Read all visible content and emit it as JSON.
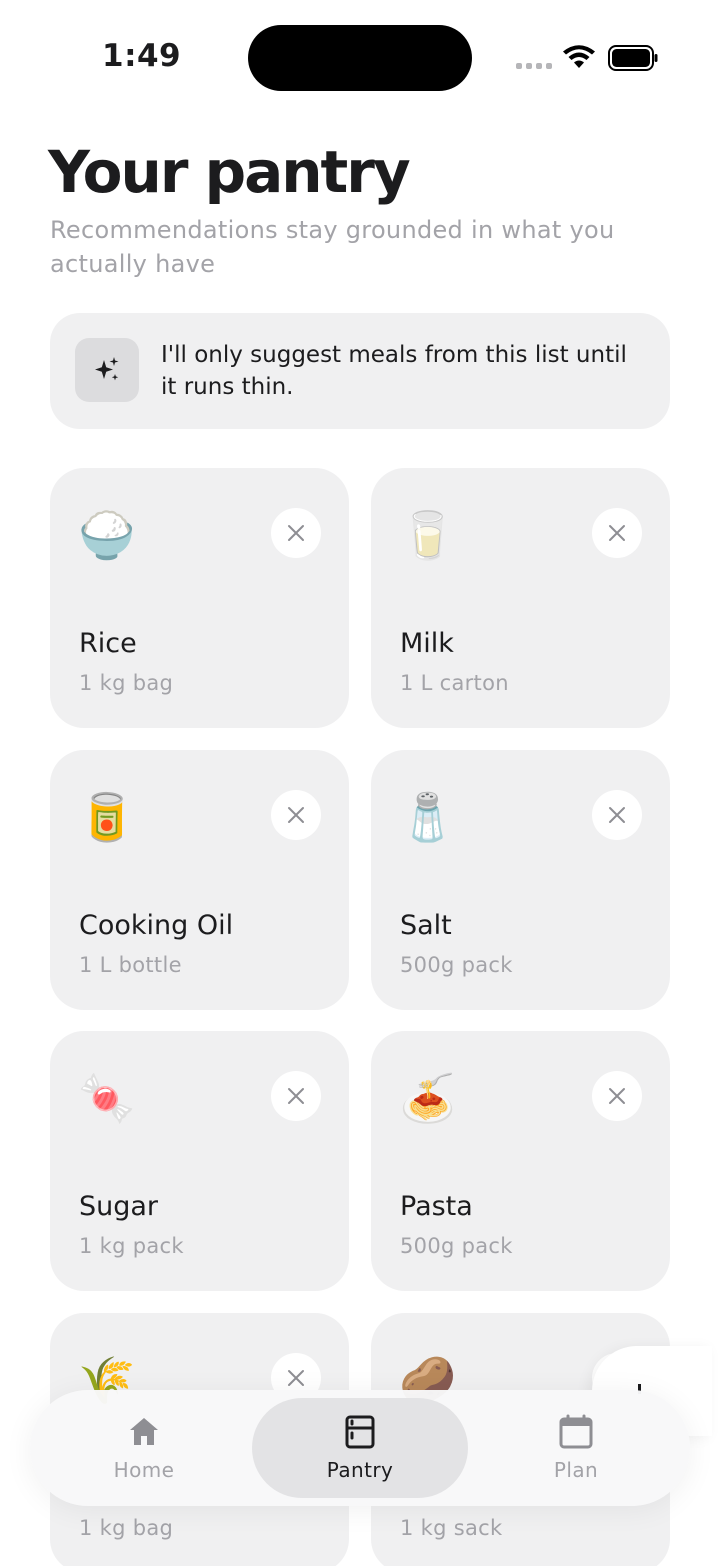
{
  "status_bar": {
    "time": "1:49"
  },
  "header": {
    "title": "Your pantry",
    "subtitle": "Recommendations stay grounded in what you actually have"
  },
  "banner": {
    "icon": "sparkles-icon",
    "text": "I'll only suggest meals from this list until it runs thin."
  },
  "pantry_items": [
    {
      "emoji": "🍚",
      "name": "Rice",
      "qty": "1 kg bag"
    },
    {
      "emoji": "🥛",
      "name": "Milk",
      "qty": "1 L carton"
    },
    {
      "emoji": "🥫",
      "name": "Cooking Oil",
      "qty": "1 L bottle"
    },
    {
      "emoji": "🧂",
      "name": "Salt",
      "qty": "500g pack"
    },
    {
      "emoji": "🍬",
      "name": "Sugar",
      "qty": "1 kg pack"
    },
    {
      "emoji": "🍝",
      "name": "Pasta",
      "qty": "500g pack"
    },
    {
      "emoji": "🌾",
      "name": "",
      "qty": "1 kg bag"
    },
    {
      "emoji": "🥔",
      "name": "",
      "qty": "1 kg sack"
    }
  ],
  "nav": {
    "tabs": [
      {
        "label": "Home",
        "icon": "home-icon",
        "active": false
      },
      {
        "label": "Pantry",
        "icon": "fridge-icon",
        "active": true
      },
      {
        "label": "Plan",
        "icon": "calendar-icon",
        "active": false
      }
    ]
  },
  "colors": {
    "card_bg": "#f0f0f1",
    "muted_text": "#a3a3a8",
    "text": "#1c1c1e"
  }
}
